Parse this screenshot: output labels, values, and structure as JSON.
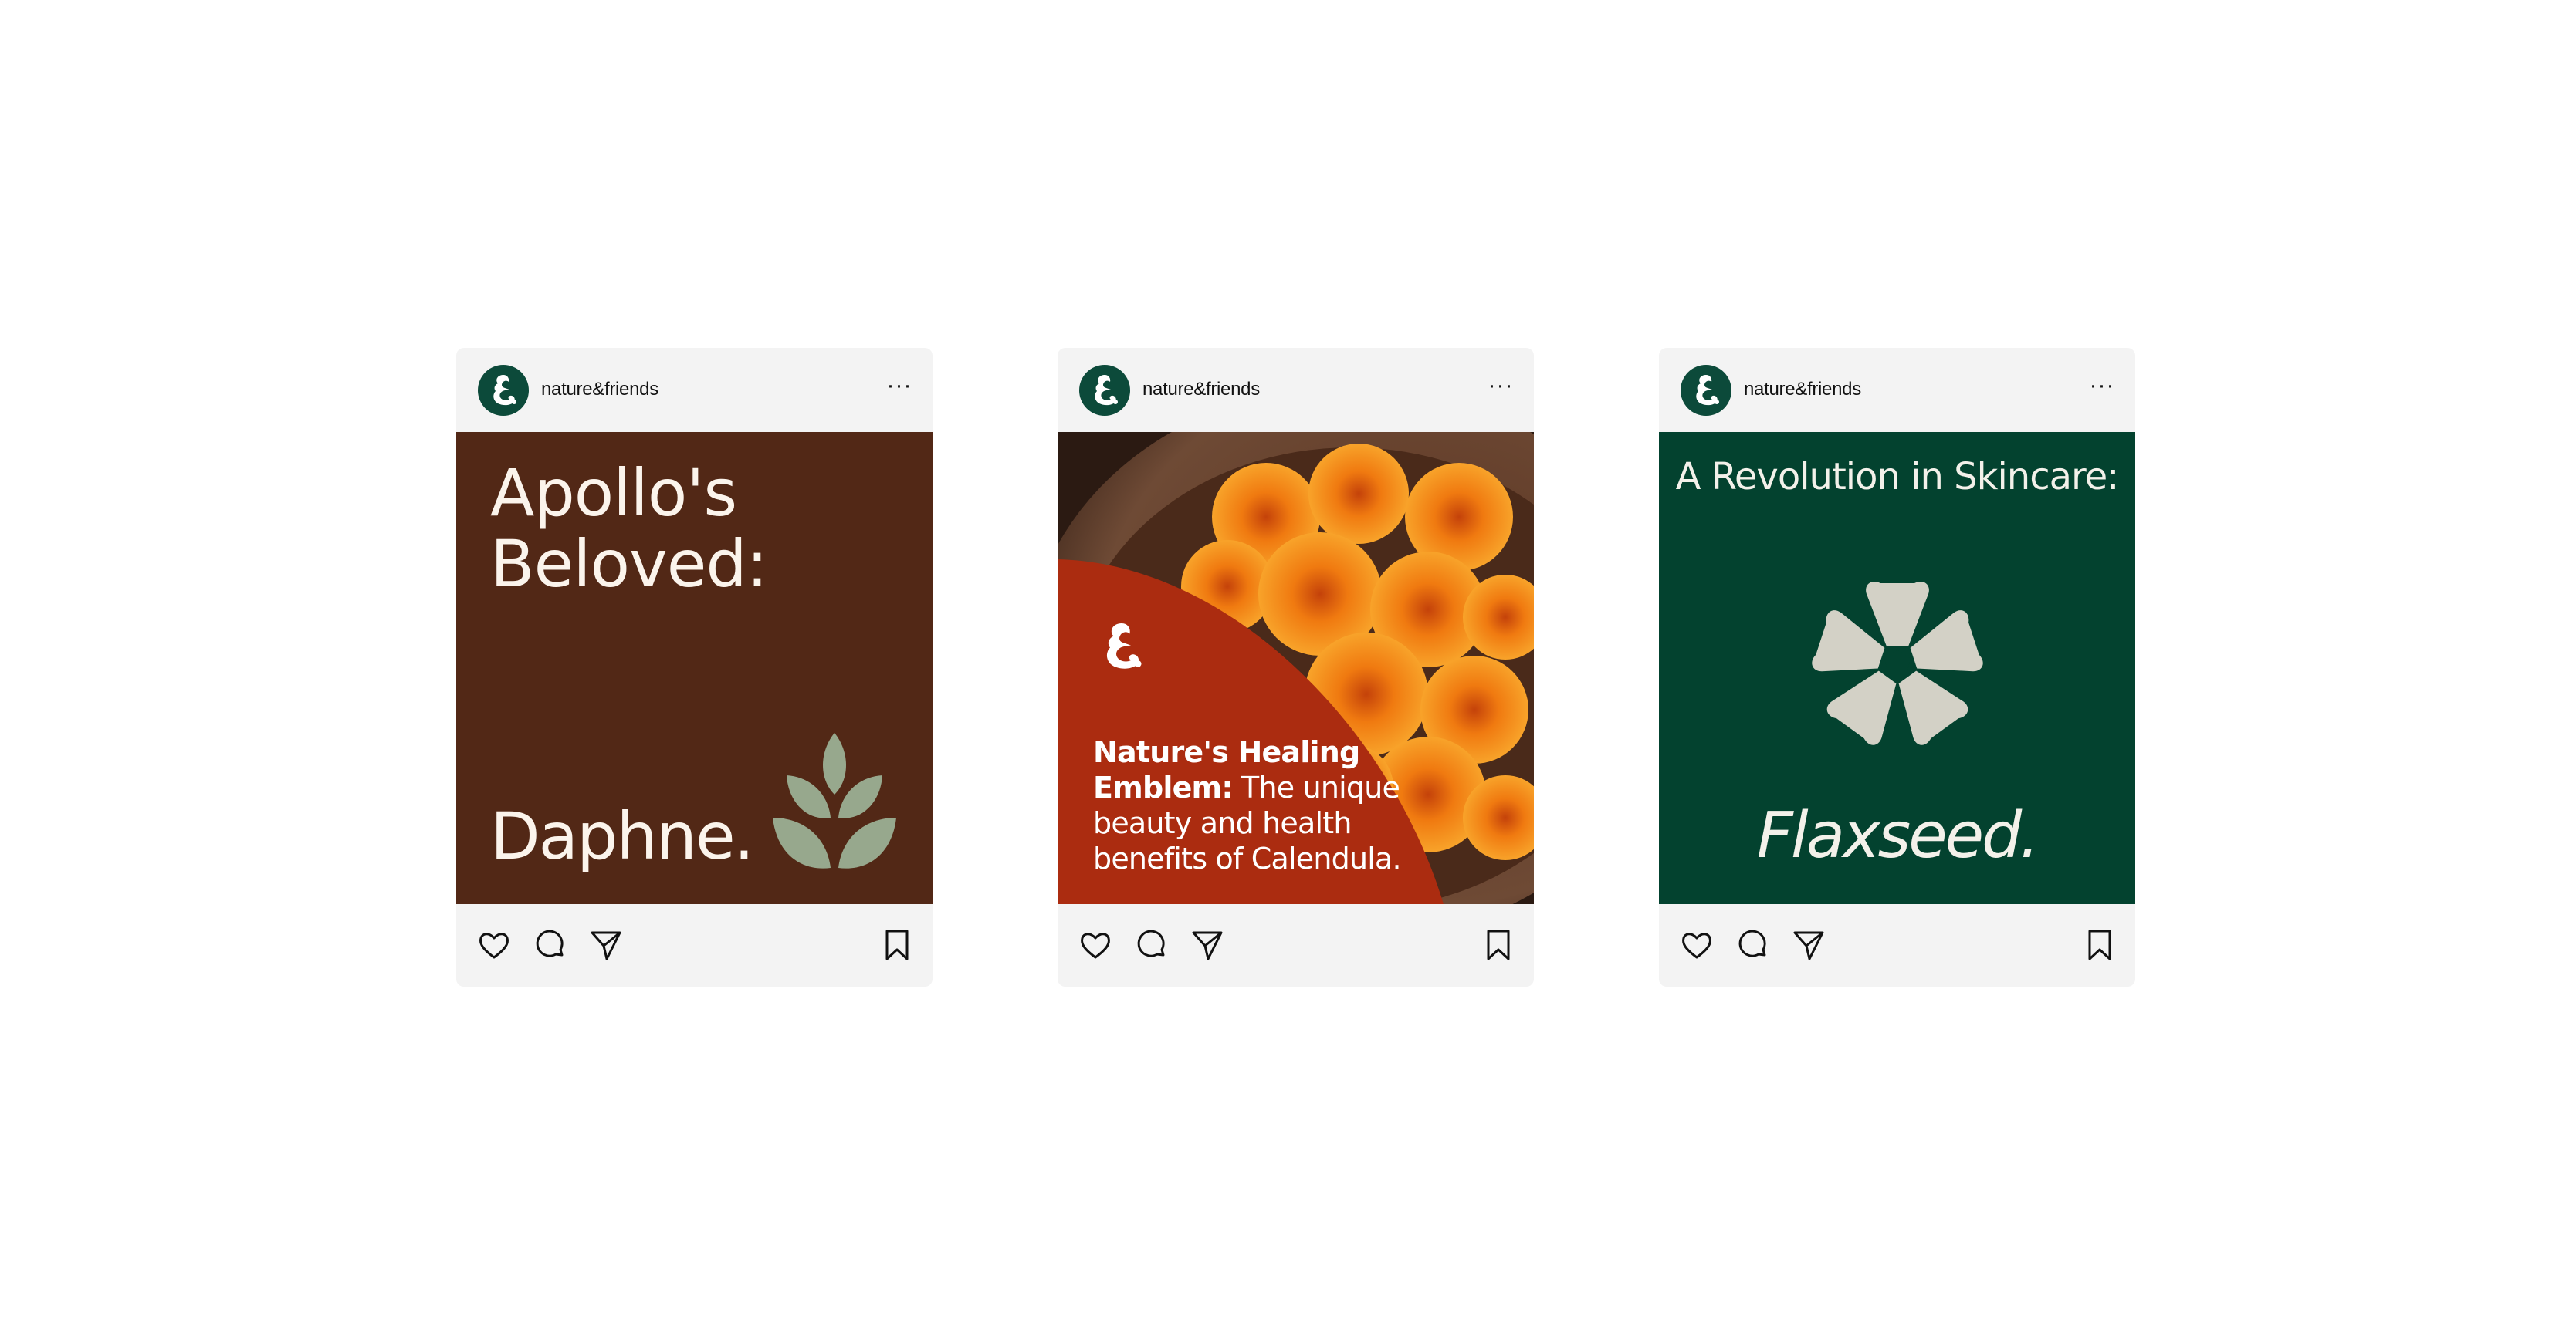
{
  "posts": [
    {
      "account": "nature&friends",
      "more_label": "···",
      "headline": "Apollo's Beloved:",
      "subject": "Daphne.",
      "background": "#522816",
      "accent": "#97a88d"
    },
    {
      "account": "nature&friends",
      "more_label": "···",
      "headline_bold": "Nature's Healing Emblem:",
      "headline_rest": " The unique beauty and health benefits of Calendula.",
      "background": "#ab2c10",
      "flower_color": "#ef7b12"
    },
    {
      "account": "nature&friends",
      "more_label": "···",
      "headline": "A Revolution in Skincare:",
      "subject": "Flaxseed.",
      "background": "#03422f",
      "accent": "#d3d1c6"
    }
  ],
  "actions": {
    "icons": [
      "heart-icon",
      "comment-icon",
      "share-icon",
      "bookmark-icon"
    ]
  },
  "brand": {
    "primary": "#0c4a3a"
  }
}
